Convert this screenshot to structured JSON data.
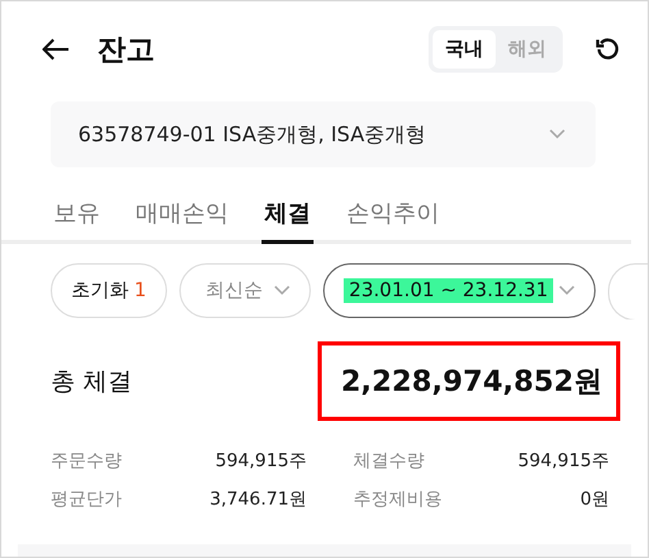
{
  "header": {
    "title": "잔고",
    "segments": [
      {
        "label": "국내",
        "selected": true
      },
      {
        "label": "해외",
        "selected": false
      }
    ]
  },
  "account": {
    "value": "63578749-01 ISA중개형, ISA중개형"
  },
  "tabs": [
    {
      "label": "보유",
      "selected": false
    },
    {
      "label": "매매손익",
      "selected": false
    },
    {
      "label": "체결",
      "selected": true
    },
    {
      "label": "손익추이",
      "selected": false
    }
  ],
  "filters": [
    {
      "kind": "reset",
      "label": "초기화",
      "count": "1"
    },
    {
      "kind": "dropdown",
      "label": "최신순",
      "highlighted": false
    },
    {
      "kind": "dropdown",
      "label": "23.01.01 ~ 23.12.31",
      "highlighted": true
    }
  ],
  "total": {
    "label": "총 체결",
    "value": "2,228,974,852원",
    "boxed": true
  },
  "stats": [
    {
      "label": "주문수량",
      "value": "594,915주"
    },
    {
      "label": "체결수량",
      "value": "594,915주"
    },
    {
      "label": "평균단가",
      "value": "3,746.71원"
    },
    {
      "label": "추정제비용",
      "value": "0원"
    }
  ]
}
